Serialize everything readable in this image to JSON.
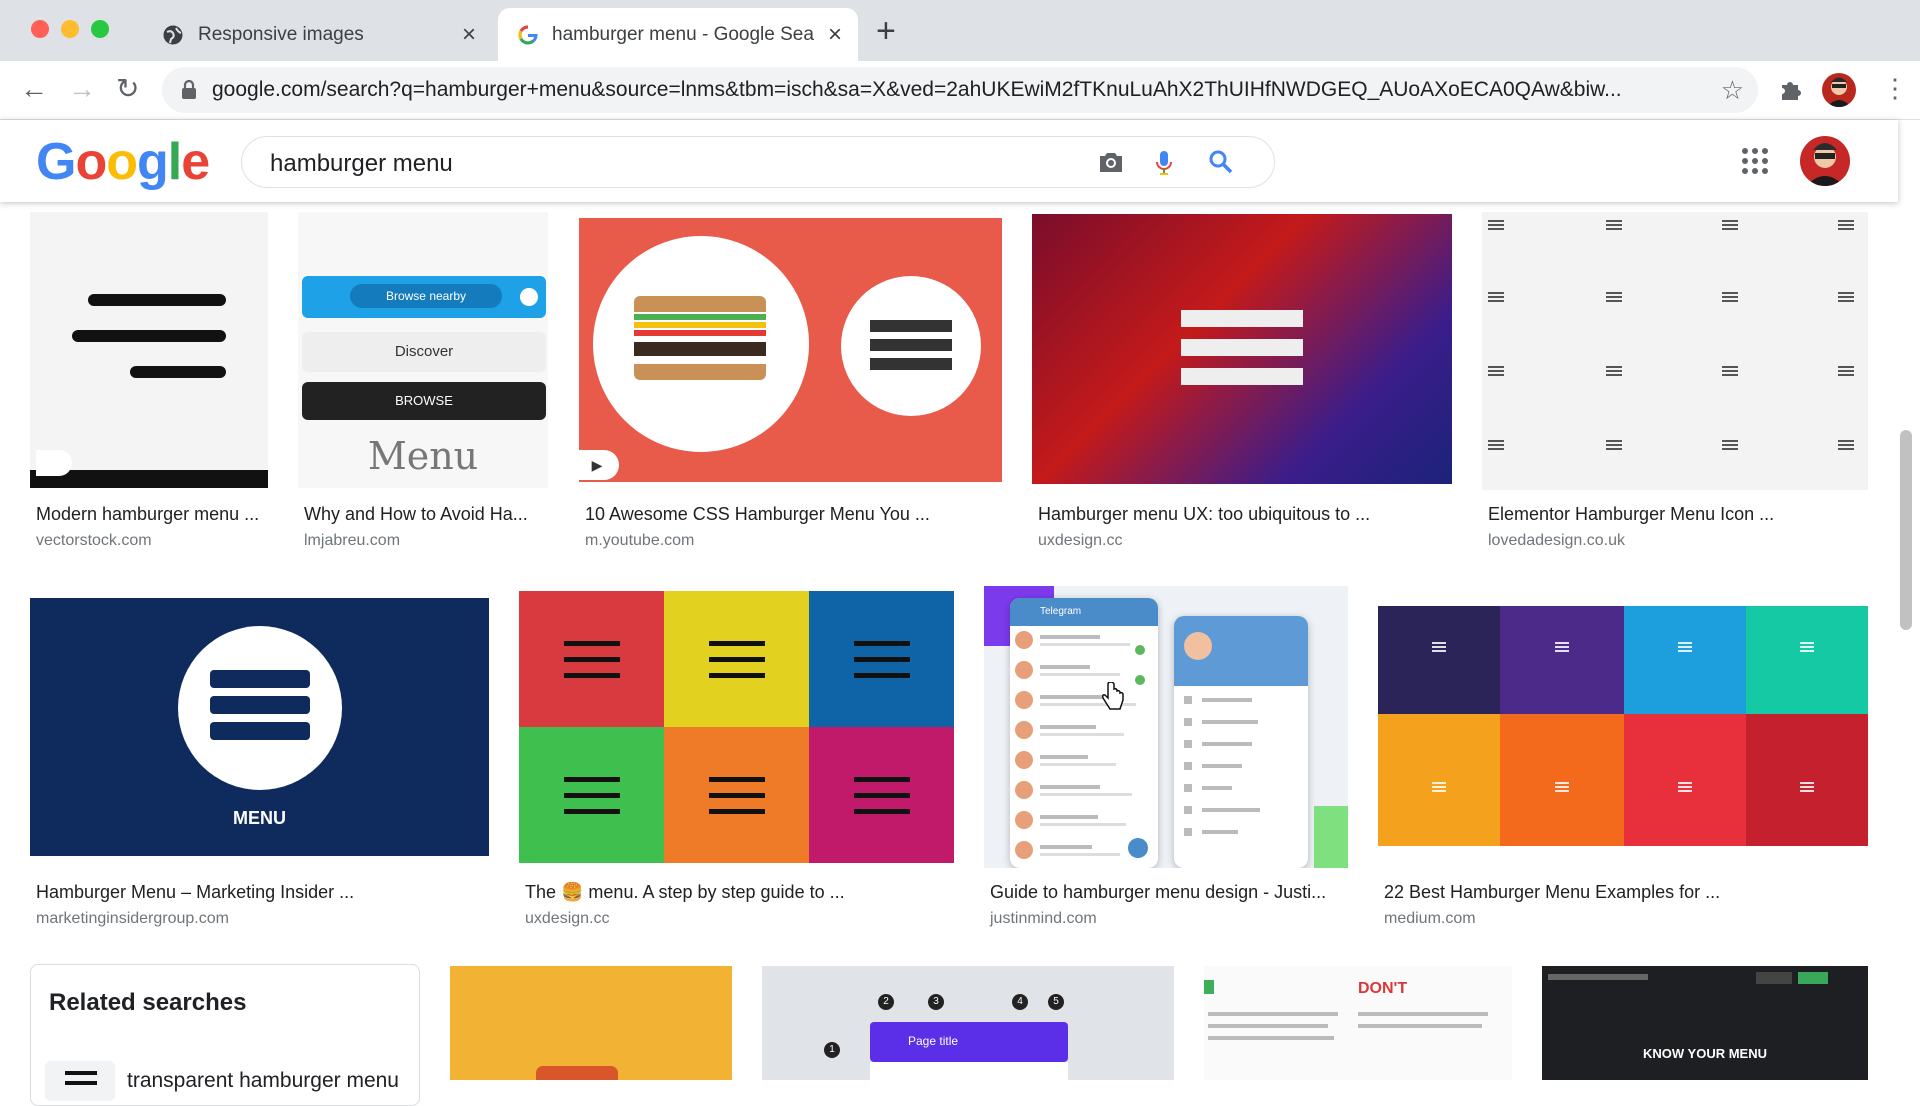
{
  "browser": {
    "tabs": [
      {
        "title": "Responsive images"
      },
      {
        "title": "hamburger menu - Google Sea"
      }
    ],
    "url": "google.com/search?q=hamburger+menu&source=lnms&tbm=isch&sa=X&ved=2ahUKEwiM2fTKnuLuAhX2ThUIHfNWDGEQ_AUoAXoECA0QAw&biw..."
  },
  "google": {
    "logo_letters": [
      "G",
      "o",
      "o",
      "g",
      "l",
      "e"
    ],
    "logo_colors": [
      "#4285f4",
      "#ea4335",
      "#fbbc05",
      "#4285f4",
      "#34a853",
      "#ea4335"
    ],
    "query": "hamburger menu"
  },
  "results": [
    {
      "caption": "Modern hamburger menu ...",
      "source": "vectorstock.com"
    },
    {
      "caption": "Why and How to Avoid Ha...",
      "source": "lmjabreu.com"
    },
    {
      "caption": "10 Awesome CSS Hamburger Menu You ...",
      "source": "m.youtube.com"
    },
    {
      "caption": "Hamburger menu UX: too ubiquitous to ...",
      "source": "uxdesign.cc"
    },
    {
      "caption": "Elementor Hamburger Menu Icon ...",
      "source": "lovedadesign.co.uk"
    },
    {
      "caption": "Hamburger Menu – Marketing Insider ...",
      "source": "marketinginsidergroup.com"
    },
    {
      "caption": "The 🍔 menu. A step by step guide to ...",
      "source": "uxdesign.cc"
    },
    {
      "caption": "Guide to hamburger menu design - Justi...",
      "source": "justinmind.com"
    },
    {
      "caption": "22 Best Hamburger Menu Examples for ...",
      "source": "medium.com"
    }
  ],
  "thumb_text": {
    "browse_nearby": "Browse nearby",
    "discover": "Discover",
    "browse": "BROWSE",
    "menu_script": "Menu",
    "menu_caps": "MENU",
    "telegram": "Telegram",
    "page_title": "Page title",
    "dont": "DON'T",
    "know_your_menu": "KNOW YOUR MENU",
    "steps": [
      "1",
      "2",
      "3",
      "4",
      "5"
    ]
  },
  "related": {
    "heading": "Related searches",
    "items": [
      "transparent hamburger menu"
    ]
  }
}
